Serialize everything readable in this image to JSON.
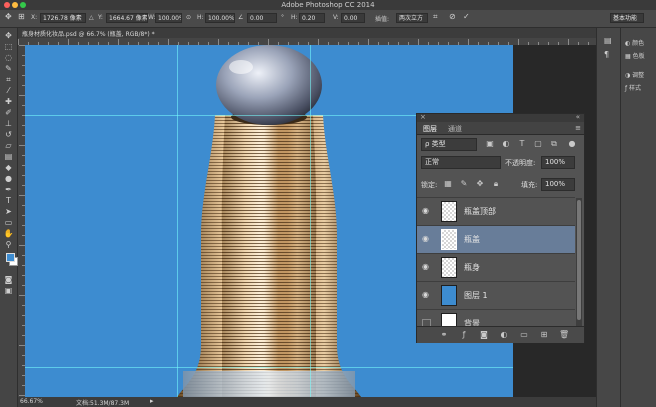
{
  "window": {
    "title": "Adobe Photoshop CC 2014"
  },
  "options_bar": {
    "x_label": "X:",
    "x_value": "1726.78 像素",
    "y_label": "Y:",
    "y_value": "1664.67 像素",
    "w_label": "W:",
    "w_value": "100.00%",
    "h_label": "H:",
    "h_value": "100.00%",
    "angle_value": "0.00",
    "hskew_label": "H:",
    "hskew_value": "0.20",
    "vskew_label": "V:",
    "vskew_value": "0.00",
    "interp_label": "插值:",
    "interp_value": "两次立方",
    "workspace": "基本功能"
  },
  "document": {
    "tab_title": "瓶身材质化妆品.psd @ 66.7% (瓶盖, RGB/8*) *",
    "zoom": "66.67%",
    "doc_info": "文档:51.3M/87.3M"
  },
  "dock": {
    "items": [
      {
        "label": "颜色",
        "icon": "color-icon"
      },
      {
        "label": "色板",
        "icon": "swatches-icon"
      },
      {
        "label": "调整",
        "icon": "adjustments-icon"
      },
      {
        "label": "样式",
        "icon": "styles-icon"
      }
    ]
  },
  "layers_panel": {
    "tabs": [
      "图层",
      "通道"
    ],
    "filter_kind": "ρ 类型",
    "blend_mode": "正常",
    "opacity_label": "不透明度:",
    "opacity_value": "100%",
    "lock_label": "锁定:",
    "fill_label": "填充:",
    "fill_value": "100%",
    "layers": [
      {
        "name": "瓶盖顶部",
        "visible": true,
        "selected": false,
        "thumb": "checker"
      },
      {
        "name": "瓶盖",
        "visible": true,
        "selected": true,
        "thumb": "checker"
      },
      {
        "name": "瓶身",
        "visible": true,
        "selected": false,
        "thumb": "checker"
      },
      {
        "name": "图层 1",
        "visible": true,
        "selected": false,
        "thumb": "blue"
      },
      {
        "name": "背景",
        "visible": false,
        "selected": false,
        "thumb": "white"
      }
    ]
  },
  "colors": {
    "canvas": "#3d8cd0",
    "selected_layer": "#687d99",
    "panel": "#535353"
  }
}
